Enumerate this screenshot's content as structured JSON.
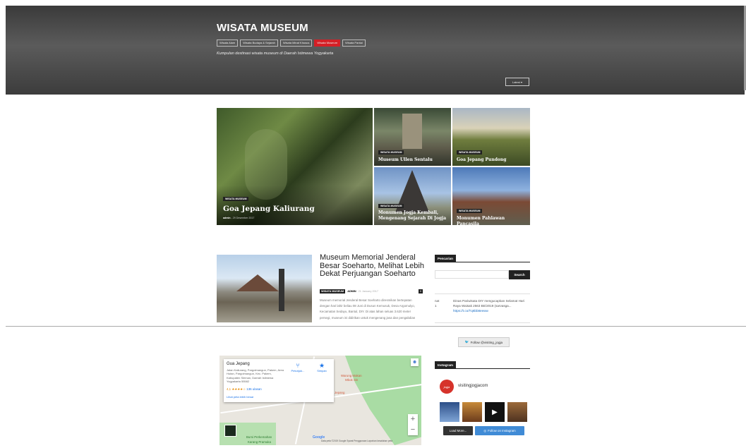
{
  "header": {
    "site_title": "WISATA MUSEUM",
    "nav": [
      {
        "label": "Wisata Alam",
        "active": false
      },
      {
        "label": "Wisata Budaya & Sejarah",
        "active": false
      },
      {
        "label": "Wisata Minat Khusus",
        "active": false
      },
      {
        "label": "Wisata Museum",
        "active": true
      },
      {
        "label": "Wisata Pantai",
        "active": false
      }
    ],
    "tagline": "Kumpulan destinasi wisata museum di Daerah Istimewa Yogyakarta",
    "sort_label": "Latest ▾"
  },
  "featured": [
    {
      "category": "WISATA MUSEUM",
      "title": "Goa Jepang Kaliurang",
      "author": "admin",
      "date": "29 Desember 2017"
    },
    {
      "category": "WISATA MUSEUM",
      "title": "Museum Ullen Sentalu"
    },
    {
      "category": "WISATA MUSEUM",
      "title": "Goa Jepang Pundong"
    },
    {
      "category": "WISATA MUSEUM",
      "title": "Monumen Jogja Kembali, Mengenang Sejarah Di Jogja"
    },
    {
      "category": "WISATA MUSEUM",
      "title": "Monumen Pahlawan Pancasila"
    }
  ],
  "post": {
    "title": "Museum Memorial Jenderal Besar Soeharto, Melihat Lebih Dekat Perjuangan Soeharto",
    "category": "WISATA MUSEUM",
    "author": "ADMIN",
    "date": "21 January 2017",
    "comments": "0",
    "excerpt": "Museum memorial Jenderal Besar Soeharto diresmikan bertepatan dengan hari lahir beliau 08 Juni di Dusun Kemusuk, Desa Argomulyo, Kecamatan Sedayu, Bantul, DIY. Di atas lahan seluas 3.620 meter persegi, museum ini didirikan untuk mengenang jasa dan pengabdian"
  },
  "sidebar": {
    "search_heading": "Pencarian",
    "search_button": "Search",
    "tweet_left": "nat\n1",
    "tweet_text": "Dinas Pariwisata DIY mengucapkan Selamat Hari Raya Waisak 2563 BE/2019 (sarvasga...",
    "tweet_link": "https://t.co/Tq6bb8eeww",
    "follow_twitter": "Follow @visiting_jogja",
    "instagram_heading": "Instagram",
    "instagram_user": "visitingjogjacom",
    "instagram_logo": "jogja",
    "load_more": "Load More...",
    "follow_instagram": "Follow on Instagram"
  },
  "map": {
    "place_name": "Gua Jepang",
    "address": "Jalan Kaliurang, Pargolmangun, Pakem, Area Hutan, Pargolmangun, Kec. Pakem, Kabupaten Sleman, Daerah Istimewa Yogyakarta 55582",
    "rating": "4,1 ★★★★☆",
    "reviews": "136 ulasan",
    "bigger_map": "Lihat peta lebih besar",
    "directions": "Petunjuk...",
    "save": "Simpan",
    "label_warung": "Warung Makan",
    "label_warung2": "Mbok Sin",
    "label_jepang": "Jepang",
    "label_bumi": "Bumi Perkemahan",
    "label_bumi2": "Karang Pramuka",
    "google": "Google",
    "footer": "Data peta ©2019 Google   Syarat Penggunaan   Laporkan kesalahan peta"
  },
  "colors": {
    "accent": "#d51f26",
    "instagram_blue": "#408bd6",
    "header_bg": "#4a4a4a"
  }
}
